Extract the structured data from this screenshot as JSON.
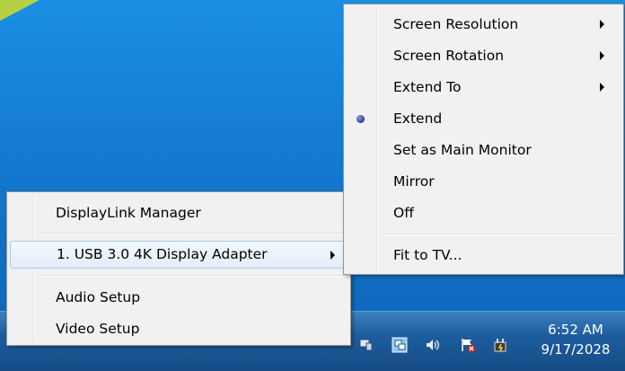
{
  "left_menu": {
    "items": [
      {
        "label": "DisplayLink Manager"
      },
      {
        "label": "1. USB 3.0 4K Display Adapter",
        "submenu": true,
        "highlighted": true
      },
      {
        "label": "Audio Setup"
      },
      {
        "label": "Video Setup"
      }
    ]
  },
  "right_menu": {
    "items": [
      {
        "label": "Screen Resolution",
        "submenu": true
      },
      {
        "label": "Screen Rotation",
        "submenu": true
      },
      {
        "label": "Extend To",
        "submenu": true
      },
      {
        "label": "Extend",
        "selected": true
      },
      {
        "label": "Set as Main Monitor"
      },
      {
        "label": "Mirror"
      },
      {
        "label": "Off"
      },
      {
        "label": "Fit to TV..."
      }
    ]
  },
  "tray": {
    "icons": [
      "network-monitor-icon",
      "displaylink-icon",
      "volume-icon",
      "action-center-flag-icon",
      "power-icon"
    ],
    "time": "6:52 AM",
    "date": "9/17/2028"
  },
  "colors": {
    "menu_bg": "#f1f1f1",
    "highlight_border": "#a8c8ec",
    "desktop_blue": "#1379cf",
    "taskbar_blue": "#1d5d9e"
  }
}
